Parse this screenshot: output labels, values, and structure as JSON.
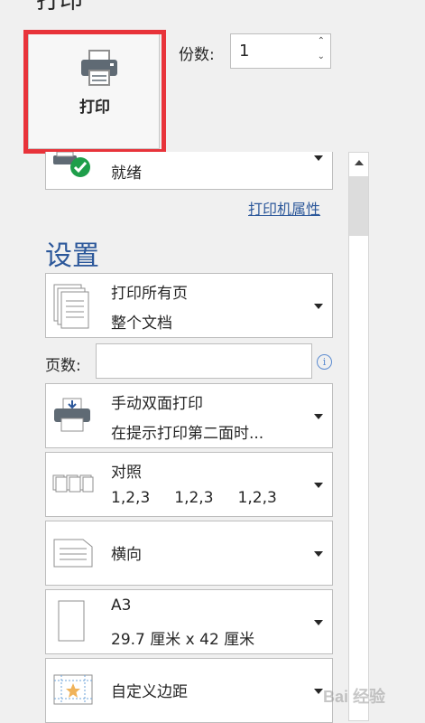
{
  "header": {
    "title_fragment": "打印"
  },
  "print_button": {
    "label": "打印"
  },
  "copies": {
    "label": "份数:",
    "value": "1"
  },
  "printer": {
    "status": "就绪",
    "properties_link": "打印机属性"
  },
  "settings": {
    "heading": "设置",
    "print_range": {
      "line1": "打印所有页",
      "line2": "整个文档"
    },
    "pages": {
      "label": "页数:",
      "value": ""
    },
    "duplex": {
      "line1": "手动双面打印",
      "line2": "在提示打印第二面时..."
    },
    "collate": {
      "line1": "对照",
      "line2": "1,2,3     1,2,3     1,2,3"
    },
    "orientation": {
      "line1": "横向"
    },
    "paper": {
      "line1": "A3",
      "line2": "29.7 厘米 x 42 厘米"
    },
    "margins": {
      "line1": "自定义边距"
    }
  },
  "watermark": {
    "text": "Bai 经验"
  },
  "colors": {
    "accent": "#2b579a",
    "highlight": "#e8333a",
    "ready_green": "#1e9e4a"
  }
}
